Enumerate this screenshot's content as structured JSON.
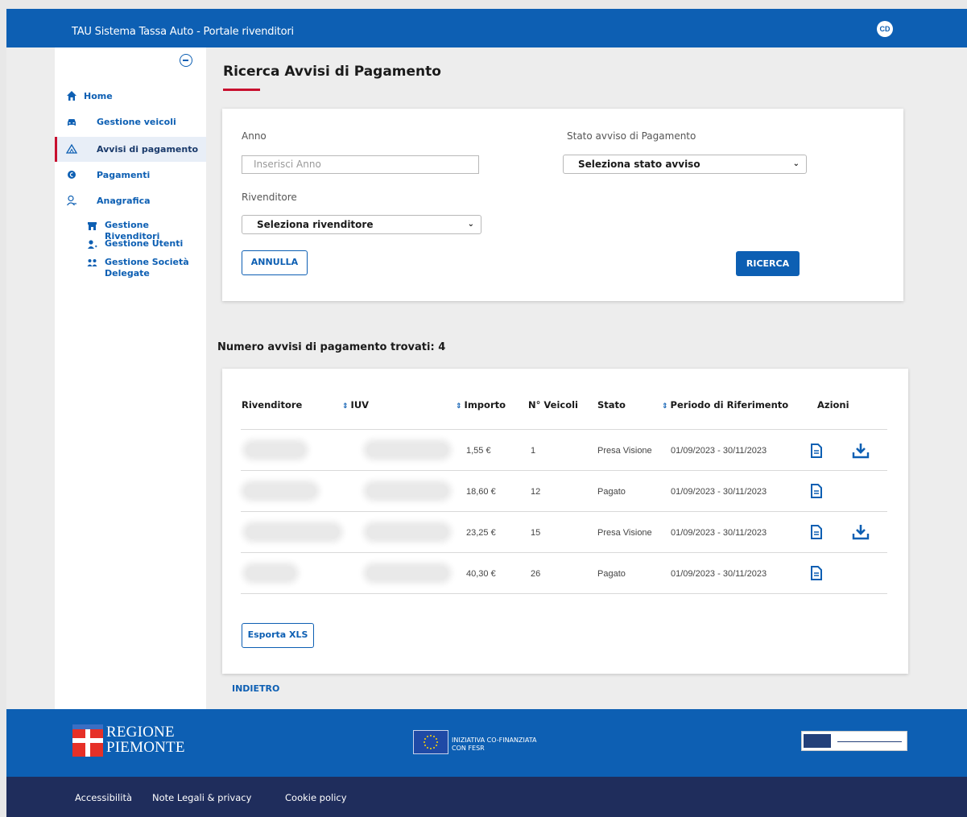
{
  "header": {
    "app_title": "TAU Sistema Tassa Auto - Portale rivenditori",
    "avatar_initials": "CD"
  },
  "sidebar": {
    "items": [
      {
        "label": "Home",
        "icon": "home-icon"
      },
      {
        "label": "Gestione veicoli",
        "icon": "car-icon"
      },
      {
        "label": "Avvisi di pagamento",
        "icon": "warning-icon",
        "active": true
      },
      {
        "label": "Pagamenti",
        "icon": "euro-icon"
      },
      {
        "label": "Anagrafica",
        "icon": "user-icon"
      }
    ],
    "subitems": [
      {
        "label": "Gestione Rivenditori",
        "icon": "shop-icon"
      },
      {
        "label": "Gestione Utenti",
        "icon": "users-icon"
      },
      {
        "label": "Gestione Società Delegate",
        "icon": "company-icon"
      }
    ]
  },
  "main": {
    "title": "Ricerca Avvisi di Pagamento",
    "filters": {
      "anno_label": "Anno",
      "anno_placeholder": "Inserisci Anno",
      "stato_label": "Stato avviso di Pagamento",
      "stato_value": "Seleziona stato avviso",
      "rivenditore_label": "Rivenditore",
      "rivenditore_value": "Seleziona rivenditore",
      "annulla": "ANNULLA",
      "ricerca": "RICERCA"
    },
    "results_count": "Numero avvisi di pagamento trovati: 4",
    "table": {
      "headers": [
        "Rivenditore",
        "IUV",
        "Importo",
        "N° Veicoli",
        "Stato",
        "Periodo di Riferimento",
        "Azioni"
      ],
      "rows": [
        {
          "importo": "1,55 €",
          "veicoli": "1",
          "stato": "Presa Visione",
          "periodo": "01/09/2023 - 30/11/2023",
          "download": true
        },
        {
          "importo": "18,60 €",
          "veicoli": "12",
          "stato": "Pagato",
          "periodo": "01/09/2023 - 30/11/2023",
          "download": false
        },
        {
          "importo": "23,25 €",
          "veicoli": "15",
          "stato": "Presa Visione",
          "periodo": "01/09/2023 - 30/11/2023",
          "download": true
        },
        {
          "importo": "40,30 €",
          "veicoli": "26",
          "stato": "Pagato",
          "periodo": "01/09/2023 - 30/11/2023",
          "download": false
        }
      ]
    },
    "export": "Esporta XLS",
    "back": "INDIETRO"
  },
  "footer": {
    "regione_line1": "REGIONE",
    "regione_line2": "PIEMONTE",
    "eu_line1": "INIZIATIVA CO-FINANZIATA",
    "eu_line2": "CON FESR",
    "links": [
      "Accessibilità",
      "Note Legali & privacy",
      "Cookie policy"
    ]
  },
  "colors": {
    "primary": "#0d5fb3",
    "accent_red": "#c8102e",
    "footer_dark": "#1f2d5c"
  }
}
